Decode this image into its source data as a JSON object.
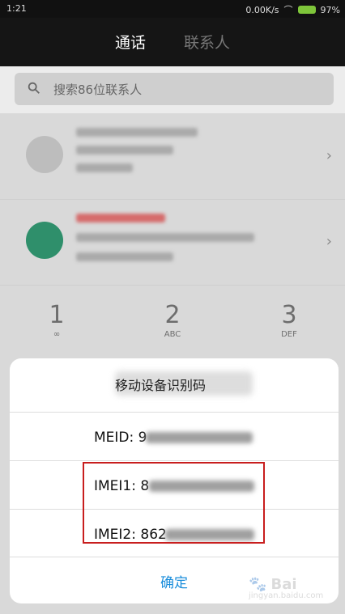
{
  "status_bar": {
    "time": "1:21",
    "speed": "0.00K/s",
    "battery_percent": "97%"
  },
  "tabs": [
    {
      "label": "通话"
    },
    {
      "label": "联系人"
    }
  ],
  "search": {
    "placeholder": "搜索86位联系人"
  },
  "dialpad": [
    {
      "digit": "1",
      "letters": "∞"
    },
    {
      "digit": "2",
      "letters": "ABC"
    },
    {
      "digit": "3",
      "letters": "DEF"
    }
  ],
  "dialog": {
    "title": "移动设备识别码",
    "meid_label": "MEID: 9",
    "imei1_label": "IMEI1: 8",
    "imei2_label": "IMEI2: 862",
    "confirm_label": "确定"
  },
  "watermark": {
    "brand": "Bai",
    "sub": "jingyan.baidu.com"
  }
}
